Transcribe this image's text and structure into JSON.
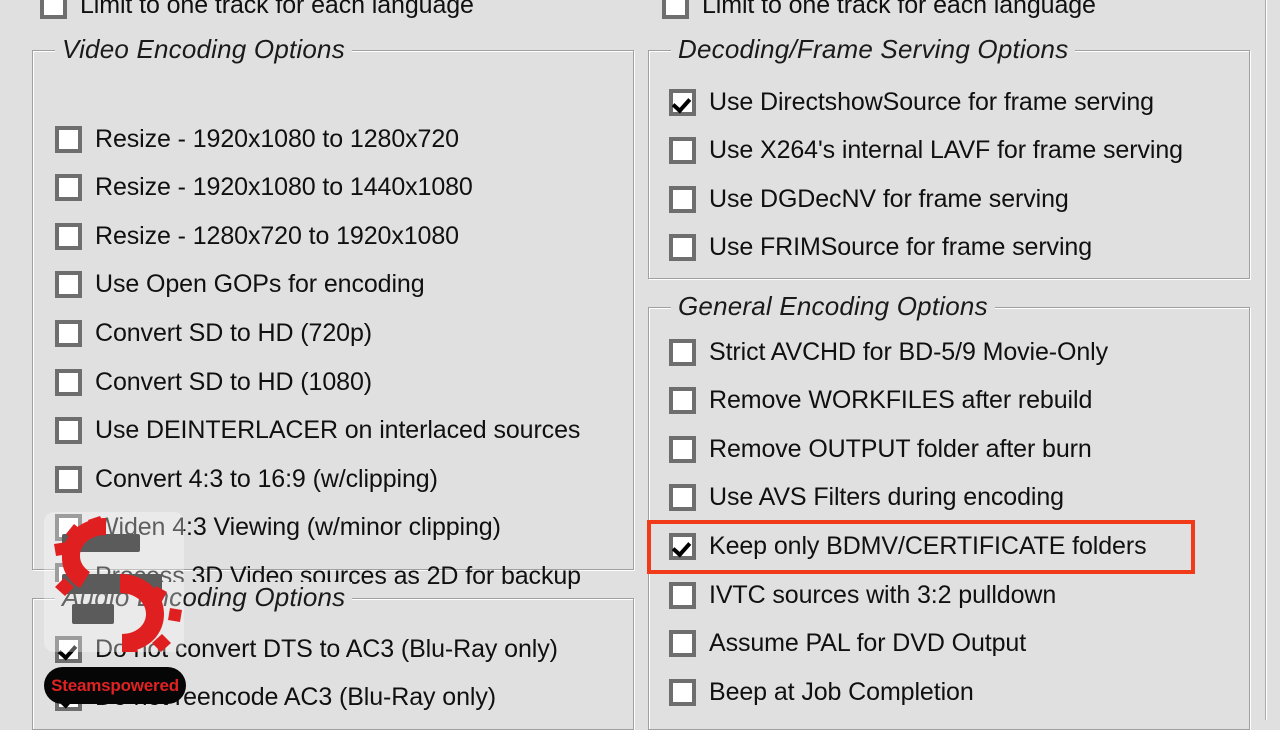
{
  "app": {
    "background_color": "#e0e0e0",
    "highlight_color": "#f03a18",
    "checkbox_border_color": "#6e6e6e"
  },
  "top_cut_rows": [
    {
      "label": "Limit to one track for each language",
      "checked": false
    },
    {
      "label": "Limit to one track for each language",
      "checked": false
    }
  ],
  "groups": [
    {
      "id": "video-encoding-options",
      "title": "Video Encoding Options",
      "rows": [
        {
          "label": "Resize  - 1920x1080 to 1280x720",
          "checked": false
        },
        {
          "label": "Resize  - 1920x1080 to 1440x1080",
          "checked": false
        },
        {
          "label": "Resize  - 1280x720 to 1920x1080",
          "checked": false
        },
        {
          "label": "Use Open GOPs for encoding",
          "checked": false
        },
        {
          "label": "Convert SD to HD (720p)",
          "checked": false
        },
        {
          "label": "Convert SD to HD (1080)",
          "checked": false
        },
        {
          "label": "Use DEINTERLACER on interlaced sources",
          "checked": false
        },
        {
          "label": "Convert 4:3 to 16:9 (w/clipping)",
          "checked": false
        },
        {
          "label": "Widen 4:3 Viewing (w/minor clipping)",
          "checked": false
        },
        {
          "label": "Process 3D Video sources as 2D for backup",
          "checked": false
        }
      ]
    },
    {
      "id": "audio-encoding-options",
      "title": "Audio Encoding Options",
      "rows": [
        {
          "label": "Do not convert DTS to AC3  (Blu-Ray only)",
          "checked": true
        },
        {
          "label": "Do not reencode AC3  (Blu-Ray only)",
          "checked": true
        }
      ]
    },
    {
      "id": "decoding-frame-serving-options",
      "title": "Decoding/Frame Serving Options",
      "rows": [
        {
          "label": "Use DirectshowSource for frame serving",
          "checked": true
        },
        {
          "label": "Use X264's internal LAVF for frame serving",
          "checked": false
        },
        {
          "label": "Use DGDecNV for frame serving",
          "checked": false
        },
        {
          "label": "Use FRIMSource for frame serving",
          "checked": false
        }
      ]
    },
    {
      "id": "general-encoding-options",
      "title": "General Encoding Options",
      "rows": [
        {
          "label": "Strict AVCHD for BD-5/9 Movie-Only",
          "checked": false
        },
        {
          "label": "Remove WORKFILES after rebuild",
          "checked": false
        },
        {
          "label": "Remove OUTPUT folder after burn",
          "checked": false
        },
        {
          "label": "Use AVS Filters during encoding",
          "checked": false
        },
        {
          "label": "Keep only BDMV/CERTIFICATE folders",
          "checked": true,
          "highlighted": true
        },
        {
          "label": "IVTC sources with 3:2 pulldown",
          "checked": false
        },
        {
          "label": "Assume PAL for DVD Output",
          "checked": false
        },
        {
          "label": "Beep at Job Completion",
          "checked": false
        }
      ]
    }
  ],
  "watermark": {
    "label": "Steamspowered",
    "logo_color": "#e02020",
    "bar_color": "#5b5b5b",
    "text_color": "#e02222",
    "pill_color": "#060606"
  }
}
